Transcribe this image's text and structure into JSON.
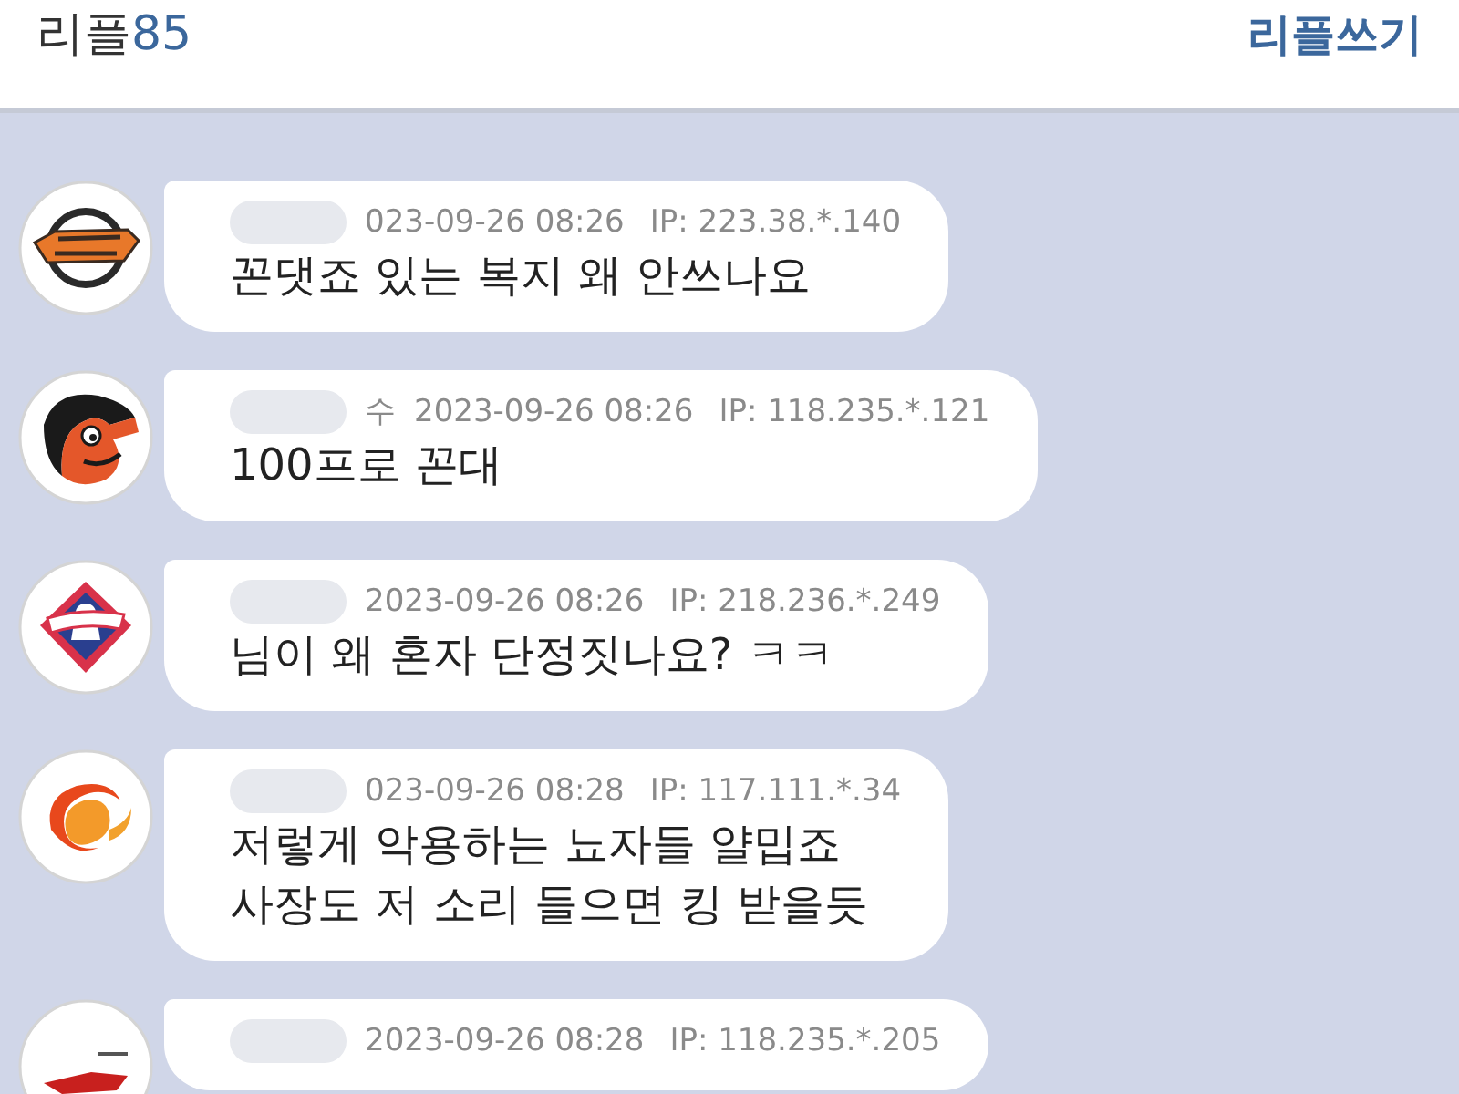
{
  "header": {
    "title": "리플",
    "count": "85",
    "write_button": "리플쓰기"
  },
  "comments": [
    {
      "avatar": {
        "kind": "wordmark"
      },
      "time": "023-09-26 08:26",
      "ip": "IP: 223.38.*.140",
      "message": "꼰댓죠 있는 복지 왜 안쓰나요"
    },
    {
      "avatar": {
        "kind": "bird"
      },
      "author": "수",
      "time": "2023-09-26 08:26",
      "ip": "IP: 118.235.*.121",
      "message": "100프로 꼰대"
    },
    {
      "avatar": {
        "kind": "diamond"
      },
      "time": "2023-09-26 08:26",
      "ip": "IP: 218.236.*.249",
      "message": "님이 왜 혼자 단정짓나요? ㅋㅋ"
    },
    {
      "avatar": {
        "kind": "swirl"
      },
      "time": "023-09-26 08:28",
      "ip": "IP: 117.111.*.34",
      "message": "저렇게 악용하는 뇨자들 얄밉죠\n사장도 저 소리 들으면 킹 받을듯"
    },
    {
      "avatar": {
        "kind": "banner"
      },
      "time": "2023-09-26 08:28",
      "ip": "IP: 118.235.*.205"
    }
  ]
}
